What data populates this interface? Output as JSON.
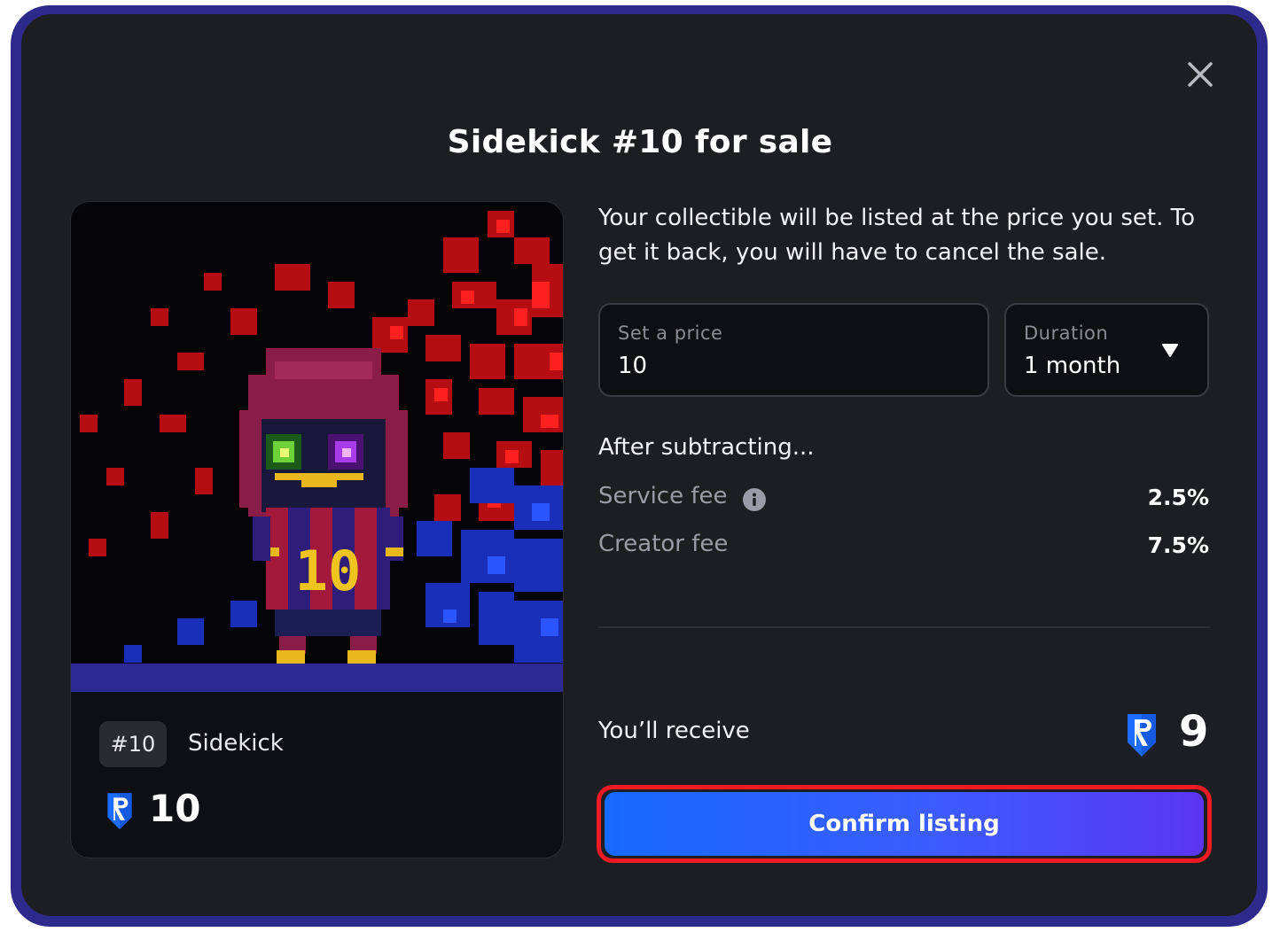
{
  "modal": {
    "title": "Sidekick #10 for sale",
    "description": "Your collectible will be listed at the price you set. To get it back, you will have to cancel the sale."
  },
  "card": {
    "badge": "#10",
    "name": "Sidekick",
    "price": "10",
    "art_jersey_number": "10"
  },
  "price_field": {
    "label": "Set a price",
    "value": "10"
  },
  "duration_field": {
    "label": "Duration",
    "value": "1 month"
  },
  "fees": {
    "heading": "After subtracting...",
    "service_label": "Service fee",
    "service_value": "2.5%",
    "creator_label": "Creator fee",
    "creator_value": "7.5%"
  },
  "receive": {
    "label": "You’ll receive",
    "value": "9"
  },
  "actions": {
    "confirm_label": "Confirm listing"
  },
  "icons": {
    "close": "close-icon",
    "dropdown": "chevron-down-icon",
    "info": "info-icon",
    "currency": "currency-shield-icon"
  },
  "colors": {
    "accent_start": "#1769ff",
    "accent_end": "#5a36f0",
    "highlight_outline": "#ee1b24",
    "frame": "#2e2a8c",
    "modal_bg": "#1d1e22"
  }
}
